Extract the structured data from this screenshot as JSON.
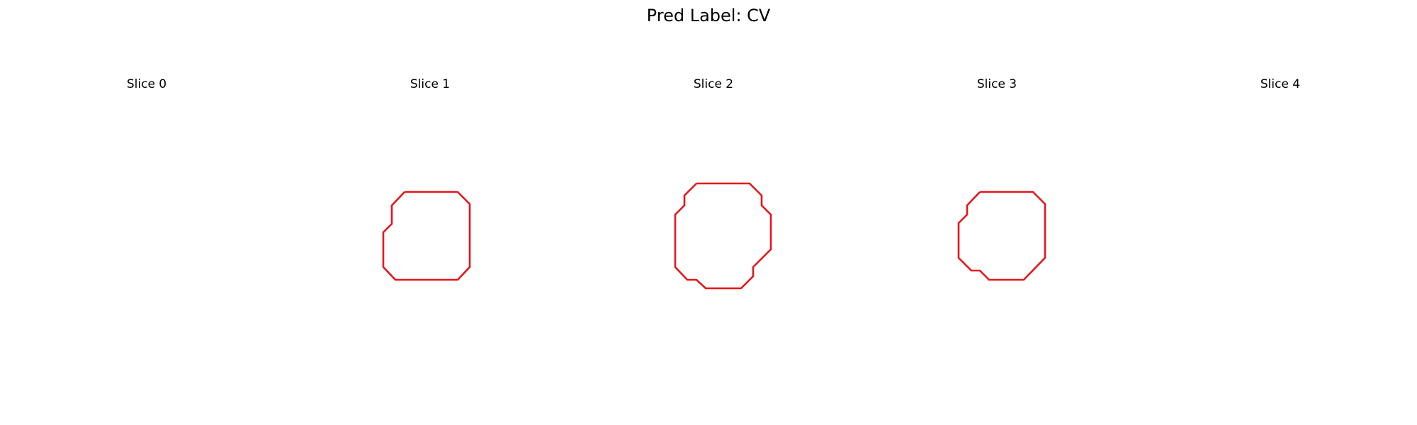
{
  "figure": {
    "title": "Pred Label: CV"
  },
  "slices": [
    {
      "title": "Slice 0"
    },
    {
      "title": "Slice 1"
    },
    {
      "title": "Slice 2"
    },
    {
      "title": "Slice 3"
    },
    {
      "title": "Slice 4"
    }
  ],
  "contour_color": "#e8141a"
}
